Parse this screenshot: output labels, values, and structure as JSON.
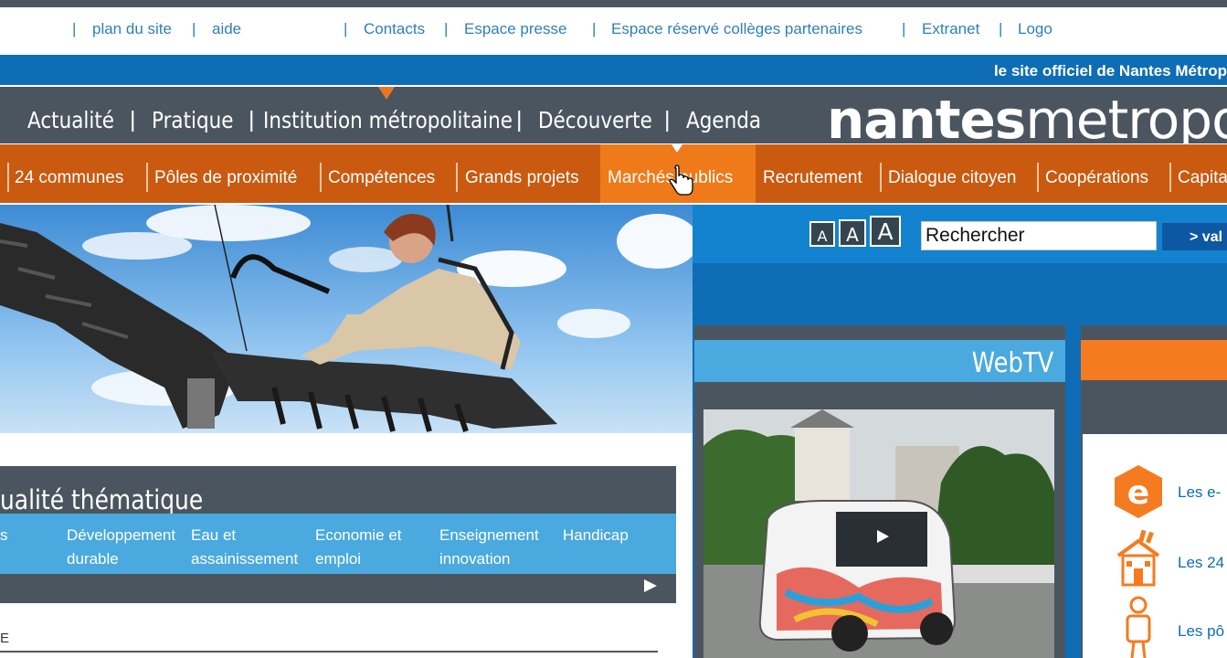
{
  "utility_nav": {
    "plan": "plan du site",
    "aide": "aide",
    "contacts": "Contacts",
    "presse": "Espace presse",
    "colleges": "Espace réservé collèges partenaires",
    "extranet": "Extranet",
    "logo": "Logo",
    "separator": "|"
  },
  "tagline": "le site officiel de Nantes Métrop",
  "main_nav": {
    "items": [
      "Actualité",
      "Pratique",
      "Institution métropolitaine",
      "Découverte",
      "Agenda"
    ],
    "separator": "|"
  },
  "logo": {
    "bold": "nantes",
    "light": "metropole"
  },
  "sub_nav": {
    "items": [
      "24 communes",
      "Pôles de proximité",
      "Compétences",
      "Grands projets",
      "Marchés publics",
      "Recrutement",
      "Dialogue citoyen",
      "Coopérations",
      "Capita"
    ],
    "active": "Marchés publics"
  },
  "text_size": {
    "small": "A",
    "medium": "A",
    "large": "A"
  },
  "search": {
    "value": "Rechercher",
    "button": "> val"
  },
  "webtv": {
    "title": "WebTV"
  },
  "right_panel": {
    "links": [
      "Les e-",
      "Les 24",
      "Les pô"
    ]
  },
  "actualite": {
    "title": "ualité thématique",
    "tabs": [
      {
        "line1": "s",
        "line2": ""
      },
      {
        "line1": "Développement",
        "line2": "durable"
      },
      {
        "line1": "Eau et",
        "line2": "assainissement"
      },
      {
        "line1": "Economie et",
        "line2": "emploi"
      },
      {
        "line1": "Enseignement",
        "line2": "innovation"
      },
      {
        "line1": "Handicap",
        "line2": ""
      }
    ],
    "bottom_letter": "E"
  },
  "colors": {
    "dark_gray": "#4b5560",
    "blue": "#0e6db4",
    "light_blue": "#4aa9de",
    "orange_dark": "#c95a10",
    "orange_active": "#ef7a1a",
    "link_blue": "#2f7fb8"
  }
}
